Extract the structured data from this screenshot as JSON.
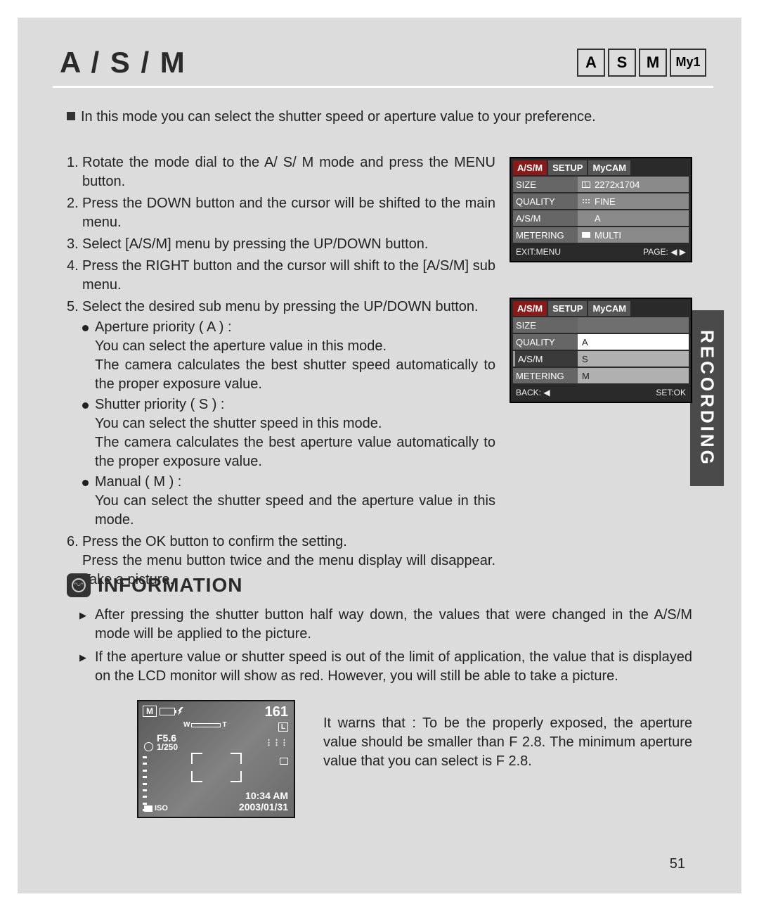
{
  "header": {
    "title": "A / S / M",
    "modes": [
      "A",
      "S",
      "M",
      "My1"
    ]
  },
  "intro": "In this mode you can select the shutter speed or aperture value to your preference.",
  "steps": {
    "s1": "Rotate the mode dial to the A/ S/ M mode and press the MENU button.",
    "s2": "Press the DOWN button and the cursor will be shifted to the main menu.",
    "s3": "Select [A/S/M] menu by pressing the UP/DOWN button.",
    "s4": "Press the RIGHT button and the cursor will shift to the [A/S/M] sub menu.",
    "s5_head": "Select the desired sub menu by pressing the UP/DOWN button.",
    "ap_title": "Aperture priority ( A ) :",
    "ap_body": "You can select the aperture value in this mode.\nThe camera calculates the best shutter speed automatically to the proper exposure value.",
    "sp_title": "Shutter priority ( S ) :",
    "sp_body": "You can select the shutter speed in this mode.\nThe camera calculates the best aperture value automatically to the proper exposure value.",
    "m_title": "Manual ( M ) :",
    "m_body": "You can select the shutter speed and the aperture value in this mode.",
    "s6": "Press the OK button to confirm the setting.\nPress the menu button twice and the menu display will disappear. Take a picture."
  },
  "menu1": {
    "tabs": [
      "A/S/M",
      "SETUP",
      "MyCAM"
    ],
    "rows": [
      {
        "label": "SIZE",
        "value": "2272x1704",
        "icon": "L"
      },
      {
        "label": "QUALITY",
        "value": "FINE",
        "icon": "dots"
      },
      {
        "label": "A/S/M",
        "value": "A",
        "icon": ""
      },
      {
        "label": "METERING",
        "value": "MULTI",
        "icon": "rect"
      }
    ],
    "footer_left": "EXIT:MENU",
    "footer_right": "PAGE: ◀ ▶"
  },
  "menu2": {
    "tabs": [
      "A/S/M",
      "SETUP",
      "MyCAM"
    ],
    "rows": [
      {
        "label": "SIZE",
        "value": ""
      },
      {
        "label": "QUALITY",
        "value": "A"
      },
      {
        "label": "A/S/M",
        "value": "S"
      },
      {
        "label": "METERING",
        "value": "M"
      }
    ],
    "footer_left": "BACK: ◀",
    "footer_right": "SET:OK"
  },
  "side_tab": "RECORDING",
  "info": {
    "heading": "INFORMATION",
    "i1": "After pressing the shutter button half way down, the values that were changed in the A/S/M mode will be applied to the picture.",
    "i2": "If the aperture value or shutter speed is out of the limit of application, the value that is displayed on the LCD monitor will show as red. However, you will still be able to take a picture."
  },
  "lcd": {
    "mode": "M",
    "shots": "161",
    "size_icon": "L",
    "fno": "F5.6",
    "shutter": "1/250",
    "zoom_w": "W",
    "zoom_t": "T",
    "iso": "ISO",
    "time": "10:34 AM",
    "date": "2003/01/31"
  },
  "warn_text": "It warns that : To be the properly exposed, the aperture value should be smaller than F 2.8. The minimum aperture value that you can select is F 2.8.",
  "page_num": "51"
}
